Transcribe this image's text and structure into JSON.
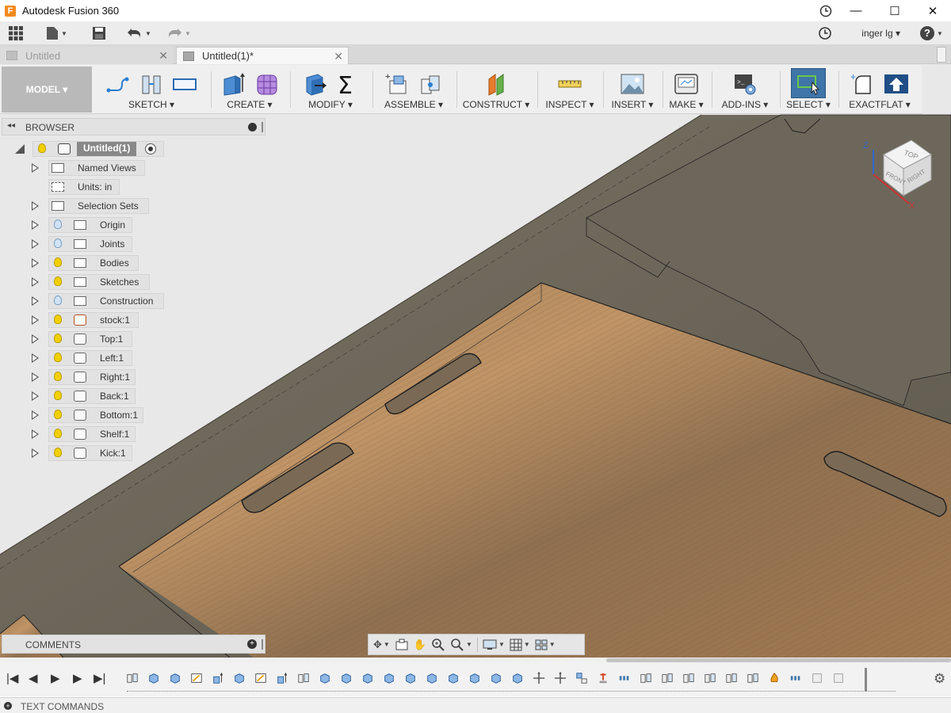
{
  "app": {
    "title": "Autodesk Fusion 360",
    "icon_letter": "F"
  },
  "window_controls": {
    "minimize": "—",
    "maximize": "☐",
    "close": "✕"
  },
  "quickbar": {
    "user": "inger lg ▾",
    "help": "?"
  },
  "tabs": [
    {
      "label": "Untitled",
      "active": false
    },
    {
      "label": "Untitled(1)*",
      "active": true
    }
  ],
  "toolbar": {
    "workspace": "MODEL ▾",
    "groups": [
      {
        "label": "SKETCH ▾"
      },
      {
        "label": "CREATE ▾"
      },
      {
        "label": "MODIFY ▾"
      },
      {
        "label": "ASSEMBLE ▾"
      },
      {
        "label": "CONSTRUCT ▾"
      },
      {
        "label": "INSPECT ▾"
      },
      {
        "label": "INSERT ▾"
      },
      {
        "label": "MAKE ▾"
      },
      {
        "label": "ADD-INS ▾"
      },
      {
        "label": "SELECT ▾"
      },
      {
        "label": "EXACTFLAT ▾"
      }
    ],
    "sigma": "Σ"
  },
  "browser": {
    "title": "BROWSER",
    "collapse": "◂◂",
    "root": "Untitled(1)",
    "items": [
      {
        "label": "Named Views"
      },
      {
        "label": "Units: in"
      },
      {
        "label": "Selection Sets"
      },
      {
        "label": "Origin"
      },
      {
        "label": "Joints"
      },
      {
        "label": "Bodies"
      },
      {
        "label": "Sketches"
      },
      {
        "label": "Construction"
      },
      {
        "label": "stock:1"
      },
      {
        "label": "Top:1"
      },
      {
        "label": "Left:1"
      },
      {
        "label": "Right:1"
      },
      {
        "label": "Back:1"
      },
      {
        "label": "Bottom:1"
      },
      {
        "label": "Shelf:1"
      },
      {
        "label": "Kick:1"
      }
    ]
  },
  "viewcube": {
    "top": "TOP",
    "front": "FRONT",
    "right": "RIGHT",
    "axis_z": "Z",
    "axis_x": "X"
  },
  "comments": {
    "title": "COMMENTS"
  },
  "timeline": {
    "controls": [
      "|◀",
      "◀",
      "▶",
      "▶",
      "▶|"
    ]
  },
  "text_commands": {
    "title": "TEXT COMMANDS"
  },
  "colors": {
    "wood": "#b08a5a",
    "board": "#6b6558",
    "background": "#e9e9e9",
    "select_highlight": "#3f75a8"
  }
}
